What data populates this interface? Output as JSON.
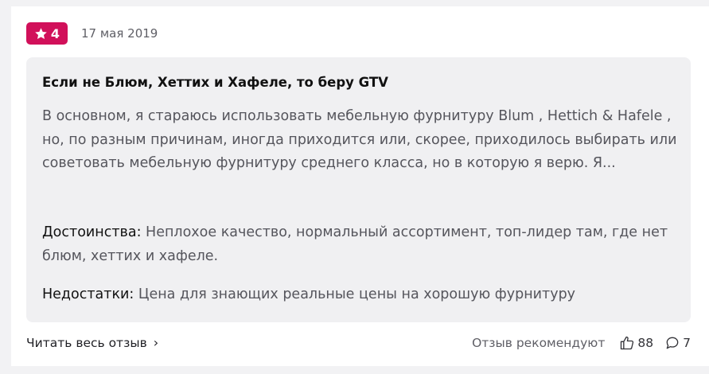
{
  "review": {
    "rating": "4",
    "date": "17 мая 2019",
    "title": "Если не Блюм, Хеттих и Хафеле, то беру GTV",
    "body": "В основном, я стараюсь использовать мебельную фурнитуру Blum , Hettich & Hafele , но, по разным причинам, иногда приходится или, скорее, приходилось выбирать или советовать мебельную фурнитуру среднего класса, но в которую я верю. Я...",
    "pros_label": "Достоинства:",
    "pros_text": "Неплохое качество, нормальный ассортимент, топ-лидер там, где нет блюм, хеттих и хафеле.",
    "cons_label": "Недостатки:",
    "cons_text": "Цена для знающих реальные цены на хорошую фурнитуру"
  },
  "footer": {
    "read_more": "Читать весь отзыв",
    "recommend_label": "Отзыв рекомендуют",
    "likes": "88",
    "comments": "7"
  },
  "colors": {
    "badge": "#d1105a",
    "box": "#f0f0f2"
  },
  "icons": [
    "star-icon",
    "chevron-right-icon",
    "thumbs-up-icon",
    "comment-icon"
  ]
}
